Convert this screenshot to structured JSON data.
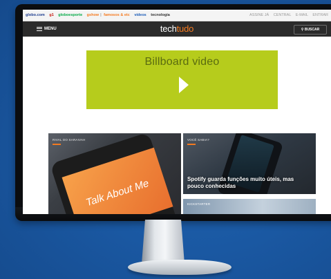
{
  "globo_bar": {
    "links": [
      {
        "label": "globo.com",
        "color": "#1e3d8f"
      },
      {
        "label": "g1",
        "color": "#c4170c"
      },
      {
        "label": "globoesporte",
        "color": "#06aa48"
      },
      {
        "label": "gshow",
        "color": "#f47a20"
      },
      {
        "label": "famosos & etc",
        "color": "#f47a20"
      },
      {
        "label": "vídeos",
        "color": "#1e5eb8"
      },
      {
        "label": "tecnologia",
        "color": "#333333"
      }
    ],
    "right_links": [
      "ASSINE JÁ",
      "CENTRAL",
      "E-MAIL",
      "ENTRAR"
    ]
  },
  "header": {
    "menu_label": "MENU",
    "logo_part1": "tech",
    "logo_part2": "tudo",
    "search_label": "BUSCAR"
  },
  "billboard": {
    "label": "Billboard video"
  },
  "cards": [
    {
      "kicker": "RIVAL DO SARAIVAH",
      "title": "",
      "phone_text": "Talk About Me"
    },
    {
      "kicker": "VOCÊ SABIA?",
      "title": "Spotify guarda funções muito úteis, mas pouco conhecidas"
    },
    {
      "kicker": "KICKSTARTER",
      "title": ""
    }
  ],
  "colors": {
    "accent": "#f47a20",
    "billboard": "#b6cc1c",
    "header": "#2b2b2b",
    "background": "#1a58a2"
  }
}
